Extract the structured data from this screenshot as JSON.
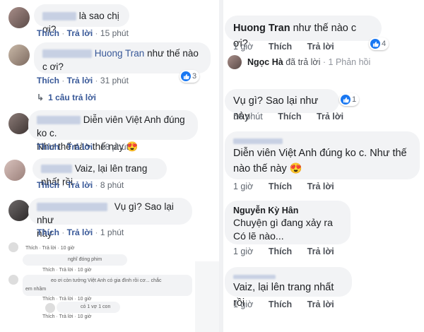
{
  "left": {
    "c1": {
      "text": "là sao chị ơi?",
      "like": "Thích",
      "reply": "Trả lời",
      "time": "15 phút"
    },
    "c2": {
      "mention": "Huong Tran",
      "text": "như thế nào c ơi?",
      "like": "Thích",
      "reply": "Trả lời",
      "time": "31 phút",
      "react_count": "3",
      "replies": "1 câu trả lời"
    },
    "c3": {
      "text_line1": "Diễn viên Việt Anh đúng ko c.",
      "text_line2": "Như thế nào thế này 😍",
      "like": "Thích",
      "reply": "Trả lời",
      "time": "18 phút"
    },
    "c4": {
      "text": "Vaiz, lại lên trang nhất rồi",
      "like": "Thích",
      "reply": "Trả lời",
      "time": "8 phút"
    },
    "c5": {
      "text_line1": "Vụ gì? Sao lại như",
      "text_line2": "này",
      "like": "Thích",
      "reply": "Trả lời",
      "time": "1 phút"
    },
    "tiny": {
      "t1": "Thích · Trả lời · 10 giờ",
      "t2": "nghĩ đóng phim",
      "t3": "Thích · Trả lời · 10 giờ",
      "t4": "eo ơi còn tưởng Việt Anh có gia đình rồi cơ... chắc",
      "t5": "em nhầm",
      "t6": "Thích · Trả lời · 10 giờ",
      "t7": "có 1 vợ 1 con",
      "t8": "Thích · Trả lời · 10 giờ"
    }
  },
  "right": {
    "top": {
      "name": "Huong Tran",
      "text": "như thế nào c ơi?",
      "time": "1 giờ",
      "like": "Thích",
      "reply": "Trả lời",
      "react_count": "4"
    },
    "reply_notice": {
      "name": "Ngọc Hà",
      "text": "đã trả lời",
      "count": "1 Phản hồi"
    },
    "r1": {
      "text": "Vụ gì? Sao lại như này",
      "time": "56 phút",
      "like": "Thích",
      "reply": "Trả lời",
      "react_count": "1"
    },
    "r2": {
      "text_line1": "Diễn viên Việt Anh đúng ko c. Như thế",
      "text_line2": "nào thế này 😍",
      "time": "1 giờ",
      "like": "Thích",
      "reply": "Trả lời"
    },
    "r3": {
      "name": "Nguyễn Kỳ Hân",
      "text_line1": "Chuyện gì đang xảy ra",
      "text_line2": "Có lẽ nào...",
      "time": "1 giờ",
      "like": "Thích",
      "reply": "Trả lời"
    },
    "r4": {
      "text": "Vaiz, lại lên trang nhất rồi",
      "time": "1 giờ",
      "like": "Thích",
      "reply": "Trả lời"
    }
  },
  "colors": {
    "link": "#385898",
    "like_blue": "#1877f2",
    "bubble": "#f2f3f5",
    "meta": "#90949c"
  }
}
